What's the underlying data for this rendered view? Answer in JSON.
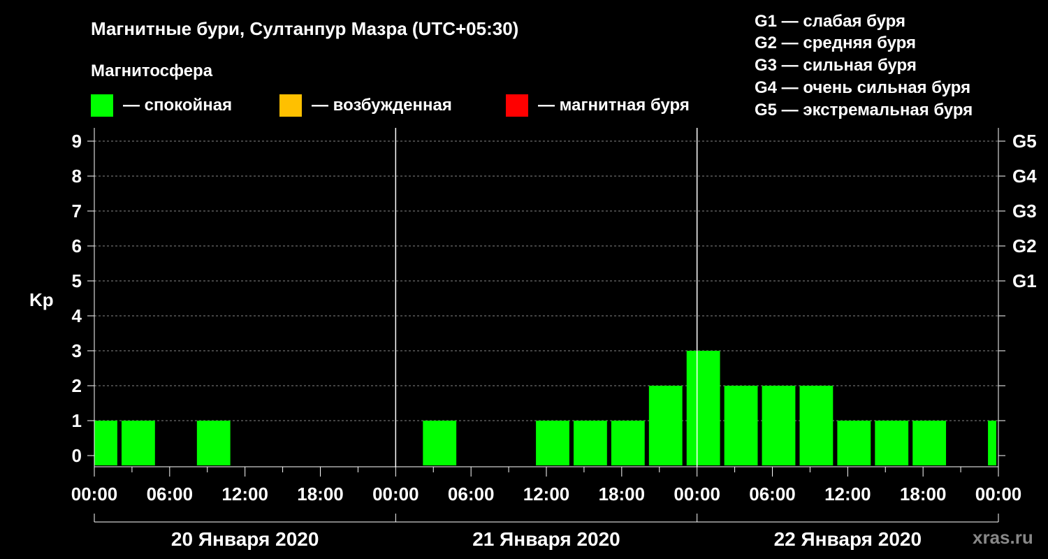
{
  "title": "Магнитные бури, Султанпур Мазра (UTC+05:30)",
  "legend": {
    "heading": "Магнитосфера",
    "items": [
      {
        "color": "#00ff00",
        "label": "— спокойная"
      },
      {
        "color": "#ffc000",
        "label": "— возбужденная"
      },
      {
        "color": "#ff0000",
        "label": "— магнитная буря"
      }
    ]
  },
  "g_scale": [
    "G1 — слабая буря",
    "G2 — средняя буря",
    "G3 — сильная буря",
    "G4 — очень сильная буря",
    "G5 — экстремальная буря"
  ],
  "watermark": "xras.ru",
  "colors": {
    "calm": "#00ff00",
    "background": "#000000",
    "grid": "#888888"
  },
  "chart_data": {
    "type": "bar",
    "ylabel": "Kp",
    "ylim": [
      0,
      9
    ],
    "yticks": [
      "0",
      "1",
      "2",
      "3",
      "4",
      "5",
      "6",
      "7",
      "8",
      "9"
    ],
    "right_axis_labels": [
      {
        "kp": 5,
        "label": "G1"
      },
      {
        "kp": 6,
        "label": "G2"
      },
      {
        "kp": 7,
        "label": "G3"
      },
      {
        "kp": 8,
        "label": "G4"
      },
      {
        "kp": 9,
        "label": "G5"
      }
    ],
    "x_range_hours": [
      0,
      72
    ],
    "xtick_labels": [
      "00:00",
      "06:00",
      "12:00",
      "18:00",
      "00:00",
      "06:00",
      "12:00",
      "18:00",
      "00:00",
      "06:00",
      "12:00",
      "18:00",
      "00:00"
    ],
    "dates": [
      "20 Января 2020",
      "21 Января 2020",
      "22 Января 2020"
    ],
    "grid": true,
    "series": [
      {
        "values": [
          {
            "start": 0,
            "end": 1.83,
            "kp": 1
          },
          {
            "start": 2.17,
            "end": 4.83,
            "kp": 1
          },
          {
            "start": 8.17,
            "end": 10.83,
            "kp": 1
          },
          {
            "start": 26.17,
            "end": 28.83,
            "kp": 1
          },
          {
            "start": 35.17,
            "end": 37.83,
            "kp": 1
          },
          {
            "start": 38.17,
            "end": 40.83,
            "kp": 1
          },
          {
            "start": 41.17,
            "end": 43.83,
            "kp": 1
          },
          {
            "start": 44.17,
            "end": 46.83,
            "kp": 2
          },
          {
            "start": 47.17,
            "end": 49.83,
            "kp": 3
          },
          {
            "start": 50.17,
            "end": 52.83,
            "kp": 2
          },
          {
            "start": 53.17,
            "end": 55.83,
            "kp": 2
          },
          {
            "start": 56.17,
            "end": 58.83,
            "kp": 2
          },
          {
            "start": 59.17,
            "end": 61.83,
            "kp": 1
          },
          {
            "start": 62.17,
            "end": 64.83,
            "kp": 1
          },
          {
            "start": 65.17,
            "end": 67.83,
            "kp": 1
          },
          {
            "start": 71.17,
            "end": 71.83,
            "kp": 1
          }
        ]
      }
    ]
  }
}
